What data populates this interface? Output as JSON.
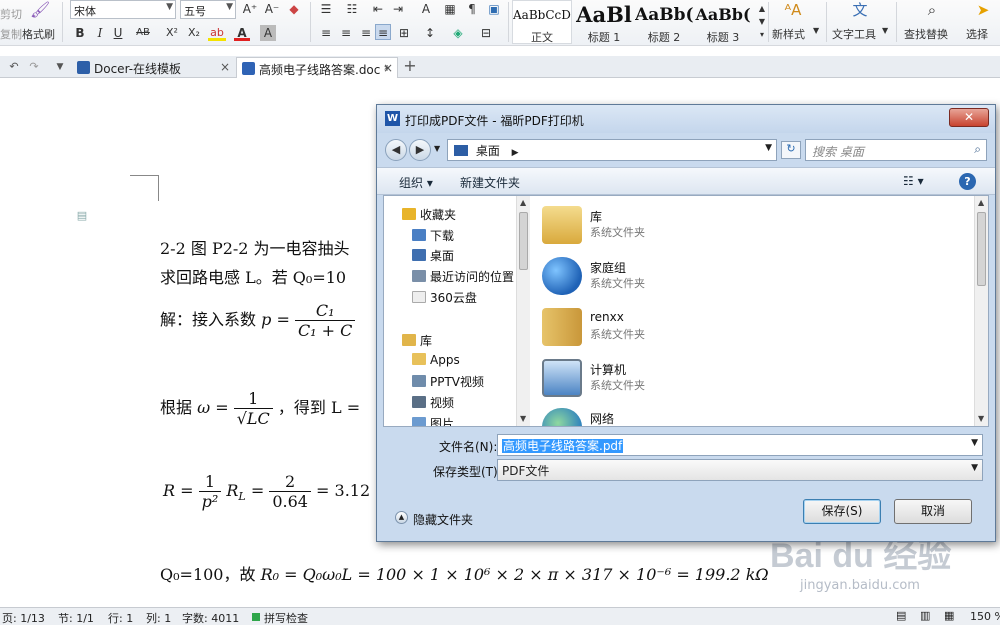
{
  "ribbon": {
    "cut_label": "剪切",
    "copy_label": "复制",
    "format_painter_label": "格式刷",
    "font_family": "宋体",
    "font_size": "五号",
    "grow_font": "A⁺",
    "shrink_font": "A⁻",
    "bold": "B",
    "italic": "I",
    "underline": "U",
    "strike": "AB",
    "superscript": "X²",
    "subscript": "X₂",
    "highlight": "ab",
    "font_color": "A",
    "char_shade": "A",
    "styles": [
      {
        "preview": "AaBbCcDd",
        "label": "正文"
      },
      {
        "preview": "AaBl",
        "label": "标题 1"
      },
      {
        "preview": "AaBb(",
        "label": "标题 2"
      },
      {
        "preview": "AaBb(",
        "label": "标题 3"
      }
    ],
    "new_style_label": "新样式",
    "text_tools_label": "文字工具",
    "find_replace_label": "查找替换",
    "select_label": "选择"
  },
  "tabs": [
    {
      "label": "Docer-在线模板",
      "close": "×",
      "active": false
    },
    {
      "label": "高频电子线路答案.doc *",
      "close": "×",
      "active": true
    }
  ],
  "tab_new": "+",
  "document": {
    "line1": "2-2  图 P2-2 为一电容抽头",
    "line2": "求回路电感 L。若 Q₀=10",
    "sol_prefix": "解：接入系数",
    "p_var": "p",
    "p_num": "C₁",
    "p_den": "C₁ + C",
    "omega_prefix": "根据",
    "omega_var": "ω",
    "omega_num": "1",
    "omega_den": "√LC",
    "omega_suffix": "，得到 L =",
    "r_var": "R",
    "r_num1": "1",
    "r_den1": "p²",
    "r_mid": "R",
    "r_sub": "L",
    "r_num2": "2",
    "r_den2": "0.64",
    "r_result": "= 3.12",
    "q_prefix": "Q₀=100，故",
    "q_expr": "R₀ = Q₀ω₀L = 100 × 1 × 10⁶ × 2 × π × 317 × 10⁻⁶ = 199.2  kΩ"
  },
  "status": {
    "page": "页: 1/13",
    "section": "节: 1/1",
    "row": "行: 1",
    "col": "列: 1",
    "words": "字数: 4011",
    "spell": "拼写检查",
    "zoom": "150 %"
  },
  "dialog": {
    "title": "打印成PDF文件 - 福昕PDF打印机",
    "close": "✕",
    "address": "桌面",
    "search_placeholder": "搜索 桌面",
    "toolbar": {
      "organize": "组织 ▾",
      "new_folder": "新建文件夹",
      "help": "?"
    },
    "nav": [
      {
        "label": "收藏夹",
        "icon": "star-icon",
        "color": "#e8b42a",
        "indent": 0
      },
      {
        "label": "下载",
        "icon": "download-folder-icon",
        "color": "#4a7fc4",
        "indent": 1
      },
      {
        "label": "桌面",
        "icon": "desktop-icon",
        "color": "#3f6fb0",
        "indent": 1
      },
      {
        "label": "最近访问的位置",
        "icon": "recent-places-icon",
        "color": "#7a8fa8",
        "indent": 1
      },
      {
        "label": "360云盘",
        "icon": "cloud-drive-icon",
        "color": "#dddddd",
        "indent": 1
      },
      {
        "label": "库",
        "icon": "library-icon",
        "color": "#e1b54a",
        "indent": 0
      },
      {
        "label": "Apps",
        "icon": "folder-icon",
        "color": "#e8c15a",
        "indent": 1
      },
      {
        "label": "PPTV视频",
        "icon": "video-library-icon",
        "color": "#6f8cab",
        "indent": 1
      },
      {
        "label": "视频",
        "icon": "video-library-icon",
        "color": "#5a6f86",
        "indent": 1
      },
      {
        "label": "图片",
        "icon": "pictures-icon",
        "color": "#6c9bd0",
        "indent": 1
      }
    ],
    "files": [
      {
        "name": "库",
        "type": "系统文件夹",
        "icon": "library-icon",
        "color": "#e6c063"
      },
      {
        "name": "家庭组",
        "type": "系统文件夹",
        "icon": "homegroup-icon",
        "color": "#3f8fd6"
      },
      {
        "name": "renxx",
        "type": "系统文件夹",
        "icon": "user-folder-icon",
        "color": "#d8b35a"
      },
      {
        "name": "计算机",
        "type": "系统文件夹",
        "icon": "computer-icon",
        "color": "#5b8fc7"
      },
      {
        "name": "网络",
        "type": "",
        "icon": "network-icon",
        "color": "#3f9f5a"
      }
    ],
    "filename_label": "文件名(N):",
    "filename_value": "高频电子线路答案.pdf",
    "filetype_label": "保存类型(T):",
    "filetype_value": "PDF文件",
    "hide_folders": "隐藏文件夹",
    "save_button": "保存(S)",
    "cancel_button": "取消"
  },
  "watermark": {
    "brand": "Bai du 经验",
    "url": "jingyan.baidu.com"
  }
}
